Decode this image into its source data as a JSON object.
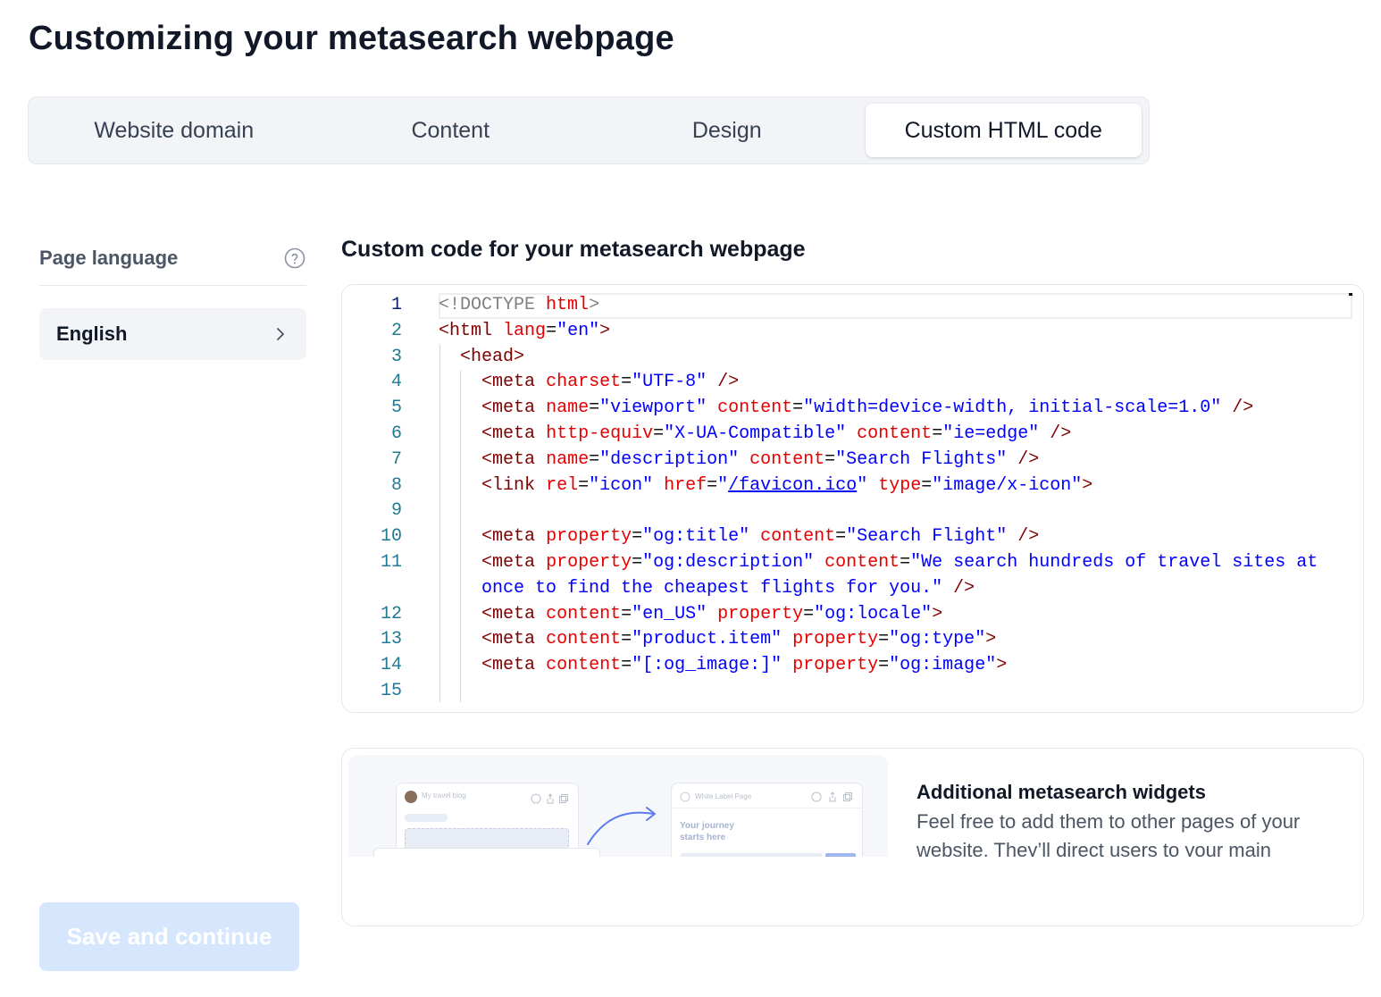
{
  "page_title": "Customizing your metasearch webpage",
  "tabs": [
    {
      "label": "Website domain",
      "active": false
    },
    {
      "label": "Content",
      "active": false
    },
    {
      "label": "Design",
      "active": false
    },
    {
      "label": "Custom HTML code",
      "active": true
    }
  ],
  "sidebar": {
    "label": "Page language",
    "help_icon": "question-circle-icon",
    "language_value": "English",
    "chevron_icon": "chevron-right-icon"
  },
  "code_section": {
    "title": "Custom code for your metasearch webpage",
    "line_numbers": [
      "1",
      "2",
      "3",
      "4",
      "5",
      "6",
      "7",
      "8",
      "9",
      "10",
      "11",
      "",
      "12",
      "13",
      "14",
      "15"
    ]
  },
  "widget": {
    "heading": "Additional metasearch widgets",
    "text": "Feel free to add them to other pages of your website. They’ll direct users to your main",
    "mock_left_title": "My travel blog",
    "mock_right_title": "White Label Page",
    "mock_right_line1": "Your journey",
    "mock_right_line2": "starts here"
  },
  "save_button": {
    "label": "Save and continue",
    "disabled": true
  },
  "colors": {
    "tag": "#800000",
    "attr": "#e50000",
    "value": "#0000ff",
    "line_number": "#237893",
    "button_disabled": "#d6e6fd"
  }
}
